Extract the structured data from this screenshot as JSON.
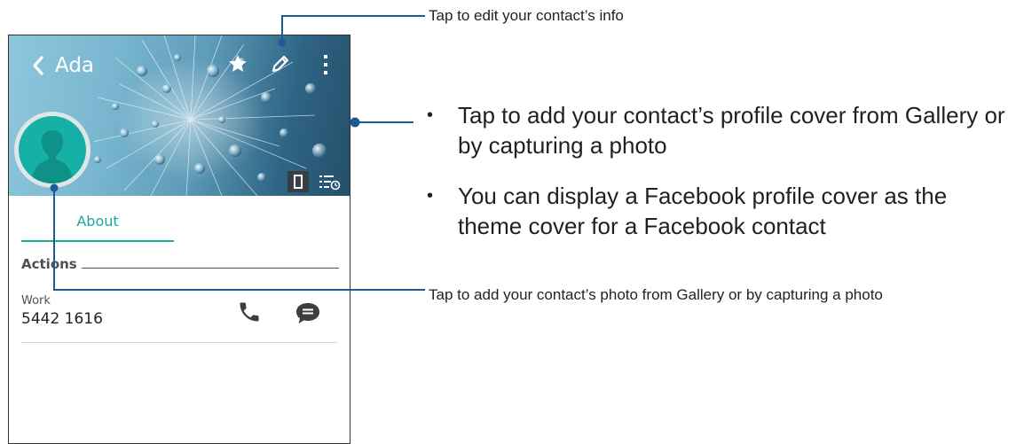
{
  "phone": {
    "contact_name": "Ada",
    "tab_about": "About",
    "section_actions": "Actions",
    "phone_type": "Work",
    "phone_number": "5442 1616",
    "icons": {
      "back": "chevron-left-icon",
      "favorite": "star-icon",
      "edit": "pencil-icon",
      "more": "more-vertical-icon",
      "avatar": "person-silhouette-icon",
      "layout_toggle": "phone-layout-icon",
      "history": "list-clock-icon",
      "call": "phone-icon",
      "message": "message-icon"
    },
    "colors": {
      "accent": "#19a99d",
      "avatar_bg": "#16b1a6",
      "callout_line": "#1d5b96"
    }
  },
  "callouts": {
    "edit_info": "Tap to edit your contact’s info",
    "cover_bullet_1": "Tap to add your contact’s profile cover from Gallery or by capturing a photo",
    "cover_bullet_2": "You can display a Facebook profile cover as the theme cover for a Facebook contact",
    "photo": "Tap to add your contact’s photo from Gallery or by capturing a photo"
  }
}
